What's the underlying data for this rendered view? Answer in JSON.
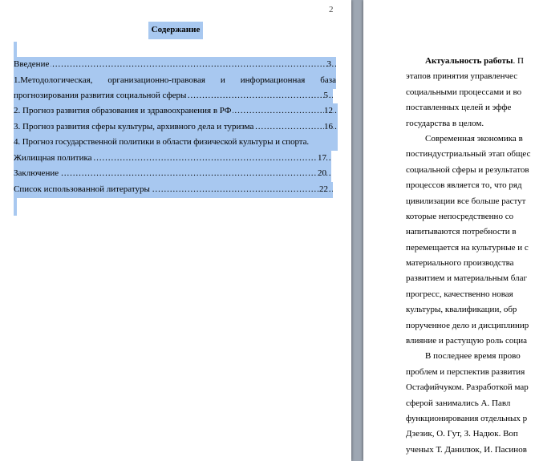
{
  "left_page": {
    "page_number": "2",
    "title": "Содержание",
    "toc": [
      {
        "text": "Введение",
        "page": "3"
      },
      {
        "text": "1.Методологическая,   организационно-правовая   и   информационная   база",
        "page": ""
      },
      {
        "text": "прогнозирования развития социальной сферы",
        "page": "5"
      },
      {
        "text": "2. Прогноз развития образования и здравоохранения в РФ",
        "page": "12"
      },
      {
        "text": "3. Прогноз развития сферы культуры, архивного дела и туризма",
        "page": "16"
      },
      {
        "text": "4. Прогноз государственной политики в области физической культуры и спорта.",
        "page": ""
      },
      {
        "text": "Жилищная политика",
        "page": "17"
      },
      {
        "text": "Заключение",
        "page": "20"
      },
      {
        "text": "Список использованной литературы",
        "page": "22"
      }
    ]
  },
  "right_page": {
    "lines": [
      {
        "bold": "Актуальность работы",
        "text": ". П"
      },
      {
        "text": "этапов принятия управленчес"
      },
      {
        "text": "социальными процессами и во"
      },
      {
        "text": "поставленных целей и эффе"
      },
      {
        "text": "государства в целом."
      },
      {
        "text": "Современная экономика в"
      },
      {
        "text": "постиндустриальный этап общес"
      },
      {
        "text": "социальной сферы и результатов"
      },
      {
        "text": "процессов является то, что ряд"
      },
      {
        "text": "цивилизации все больше растут"
      },
      {
        "text": "которые непосредственно со"
      },
      {
        "text": "напитываются потребности в"
      },
      {
        "text": "перемещается на культурные и с"
      },
      {
        "text": "материального производства"
      },
      {
        "text": "развитием и материальным благ"
      },
      {
        "text": "прогресс, качественно новая"
      },
      {
        "text": "культуры, квалификации, обр"
      },
      {
        "text": "порученное дело и дисциплинир"
      },
      {
        "text": "влияние и растущую роль социа"
      },
      {
        "text": "В последнее время прово"
      },
      {
        "text": "проблем и перспектив развития"
      },
      {
        "text": "Остафийчуком. Разработкой мар"
      },
      {
        "text": "сферой занимались А. Павл"
      },
      {
        "text": "функционирования отдельных р"
      },
      {
        "text": "Дзезик, О. Гут, З. Надюк. Воп"
      },
      {
        "text": "ученых Т. Данилюк, И. Пасинов"
      }
    ]
  }
}
